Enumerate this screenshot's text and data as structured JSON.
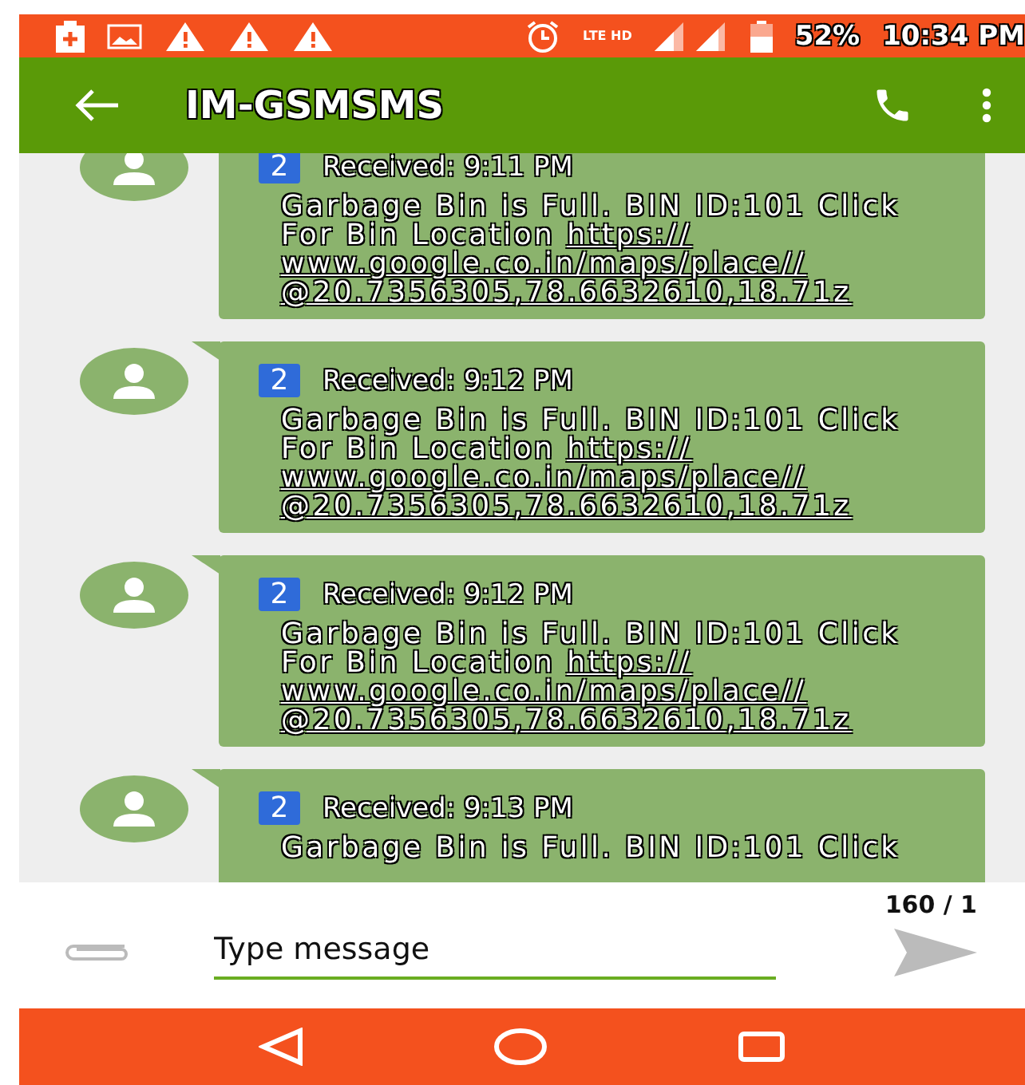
{
  "status_bar": {
    "battery": "52%",
    "time": "10:34 PM",
    "network": "LTE HD"
  },
  "app_bar": {
    "title": "IM-GSMSMS"
  },
  "messages": [
    {
      "badge": "2",
      "received": "Received: 9:11 PM",
      "text": "Garbage Bin is Full. BIN ID:101 Click For Bin Location",
      "link": [
        "https://",
        "www.google.co.in/maps/place//",
        "@20.7356305,78.6632610,18.71z"
      ]
    },
    {
      "badge": "2",
      "received": "Received: 9:12 PM",
      "text": "Garbage Bin is Full. BIN ID:101 Click For Bin Location",
      "link": [
        "https://",
        "www.google.co.in/maps/place//",
        "@20.7356305,78.6632610,18.71z"
      ]
    },
    {
      "badge": "2",
      "received": "Received: 9:12 PM",
      "text": "Garbage Bin is Full. BIN ID:101 Click For Bin Location",
      "link": [
        "https://",
        "www.google.co.in/maps/place//",
        "@20.7356305,78.6632610,18.71z"
      ]
    },
    {
      "badge": "2",
      "received": "Received: 9:13 PM",
      "text": "Garbage Bin is Full. BIN ID:101 Click"
    }
  ],
  "composer": {
    "counter": "160 / 1",
    "placeholder": "Type message"
  }
}
